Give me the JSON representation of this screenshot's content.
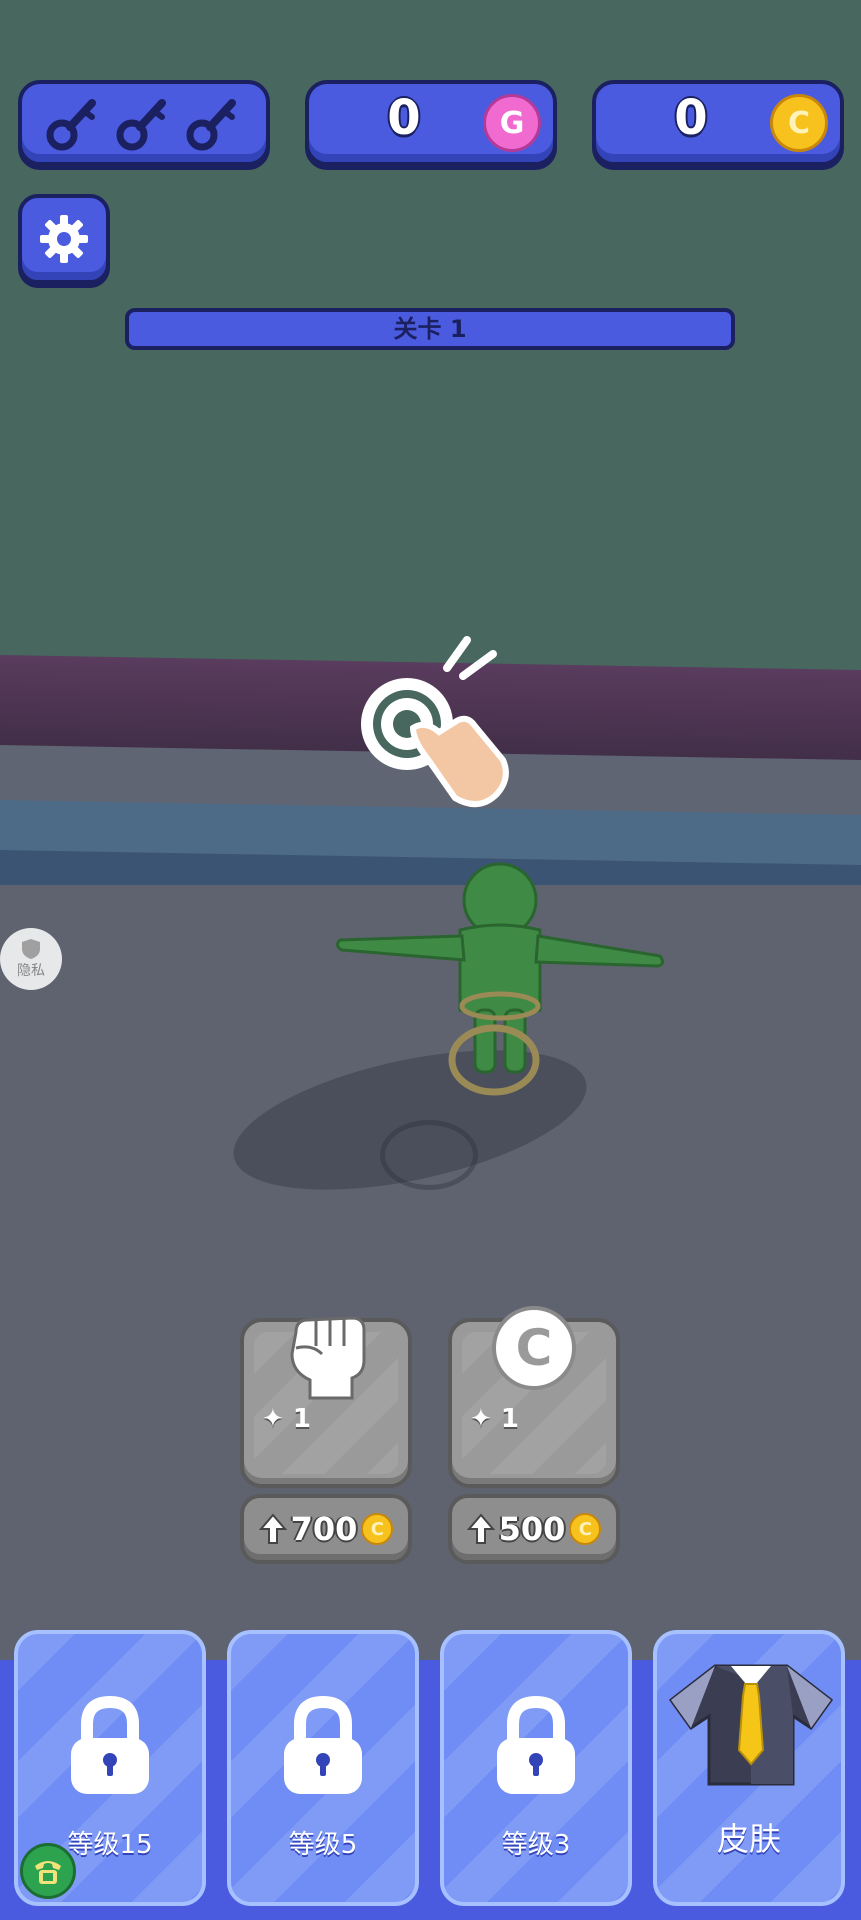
{
  "hud": {
    "gems": "0",
    "coins": "0",
    "gem_symbol": "G",
    "coin_symbol": "C",
    "key_count": 3
  },
  "level_bar": {
    "label": "关卡 1"
  },
  "privacy": {
    "label": "隐私"
  },
  "upgrades": [
    {
      "id": "power",
      "icon": "fist-icon",
      "level": "1",
      "price": "700",
      "currency_symbol": "C"
    },
    {
      "id": "income",
      "icon": "coin-icon",
      "level": "1",
      "price": "500",
      "currency_symbol": "C",
      "icon_symbol": "C"
    }
  ],
  "tabs": [
    {
      "label": "等级15",
      "locked": true
    },
    {
      "label": "等级5",
      "locked": true
    },
    {
      "label": "等级3",
      "locked": true
    },
    {
      "label": "皮肤",
      "locked": false,
      "icon": "shirt-icon"
    }
  ],
  "colors": {
    "hud_blue": "#4a5be0",
    "hud_border": "#1b2060",
    "tab_blue": "#6f8df5",
    "coin_gold": "#f7c21e",
    "gem_pink": "#f06ad0",
    "character_green": "#3f8a45"
  }
}
